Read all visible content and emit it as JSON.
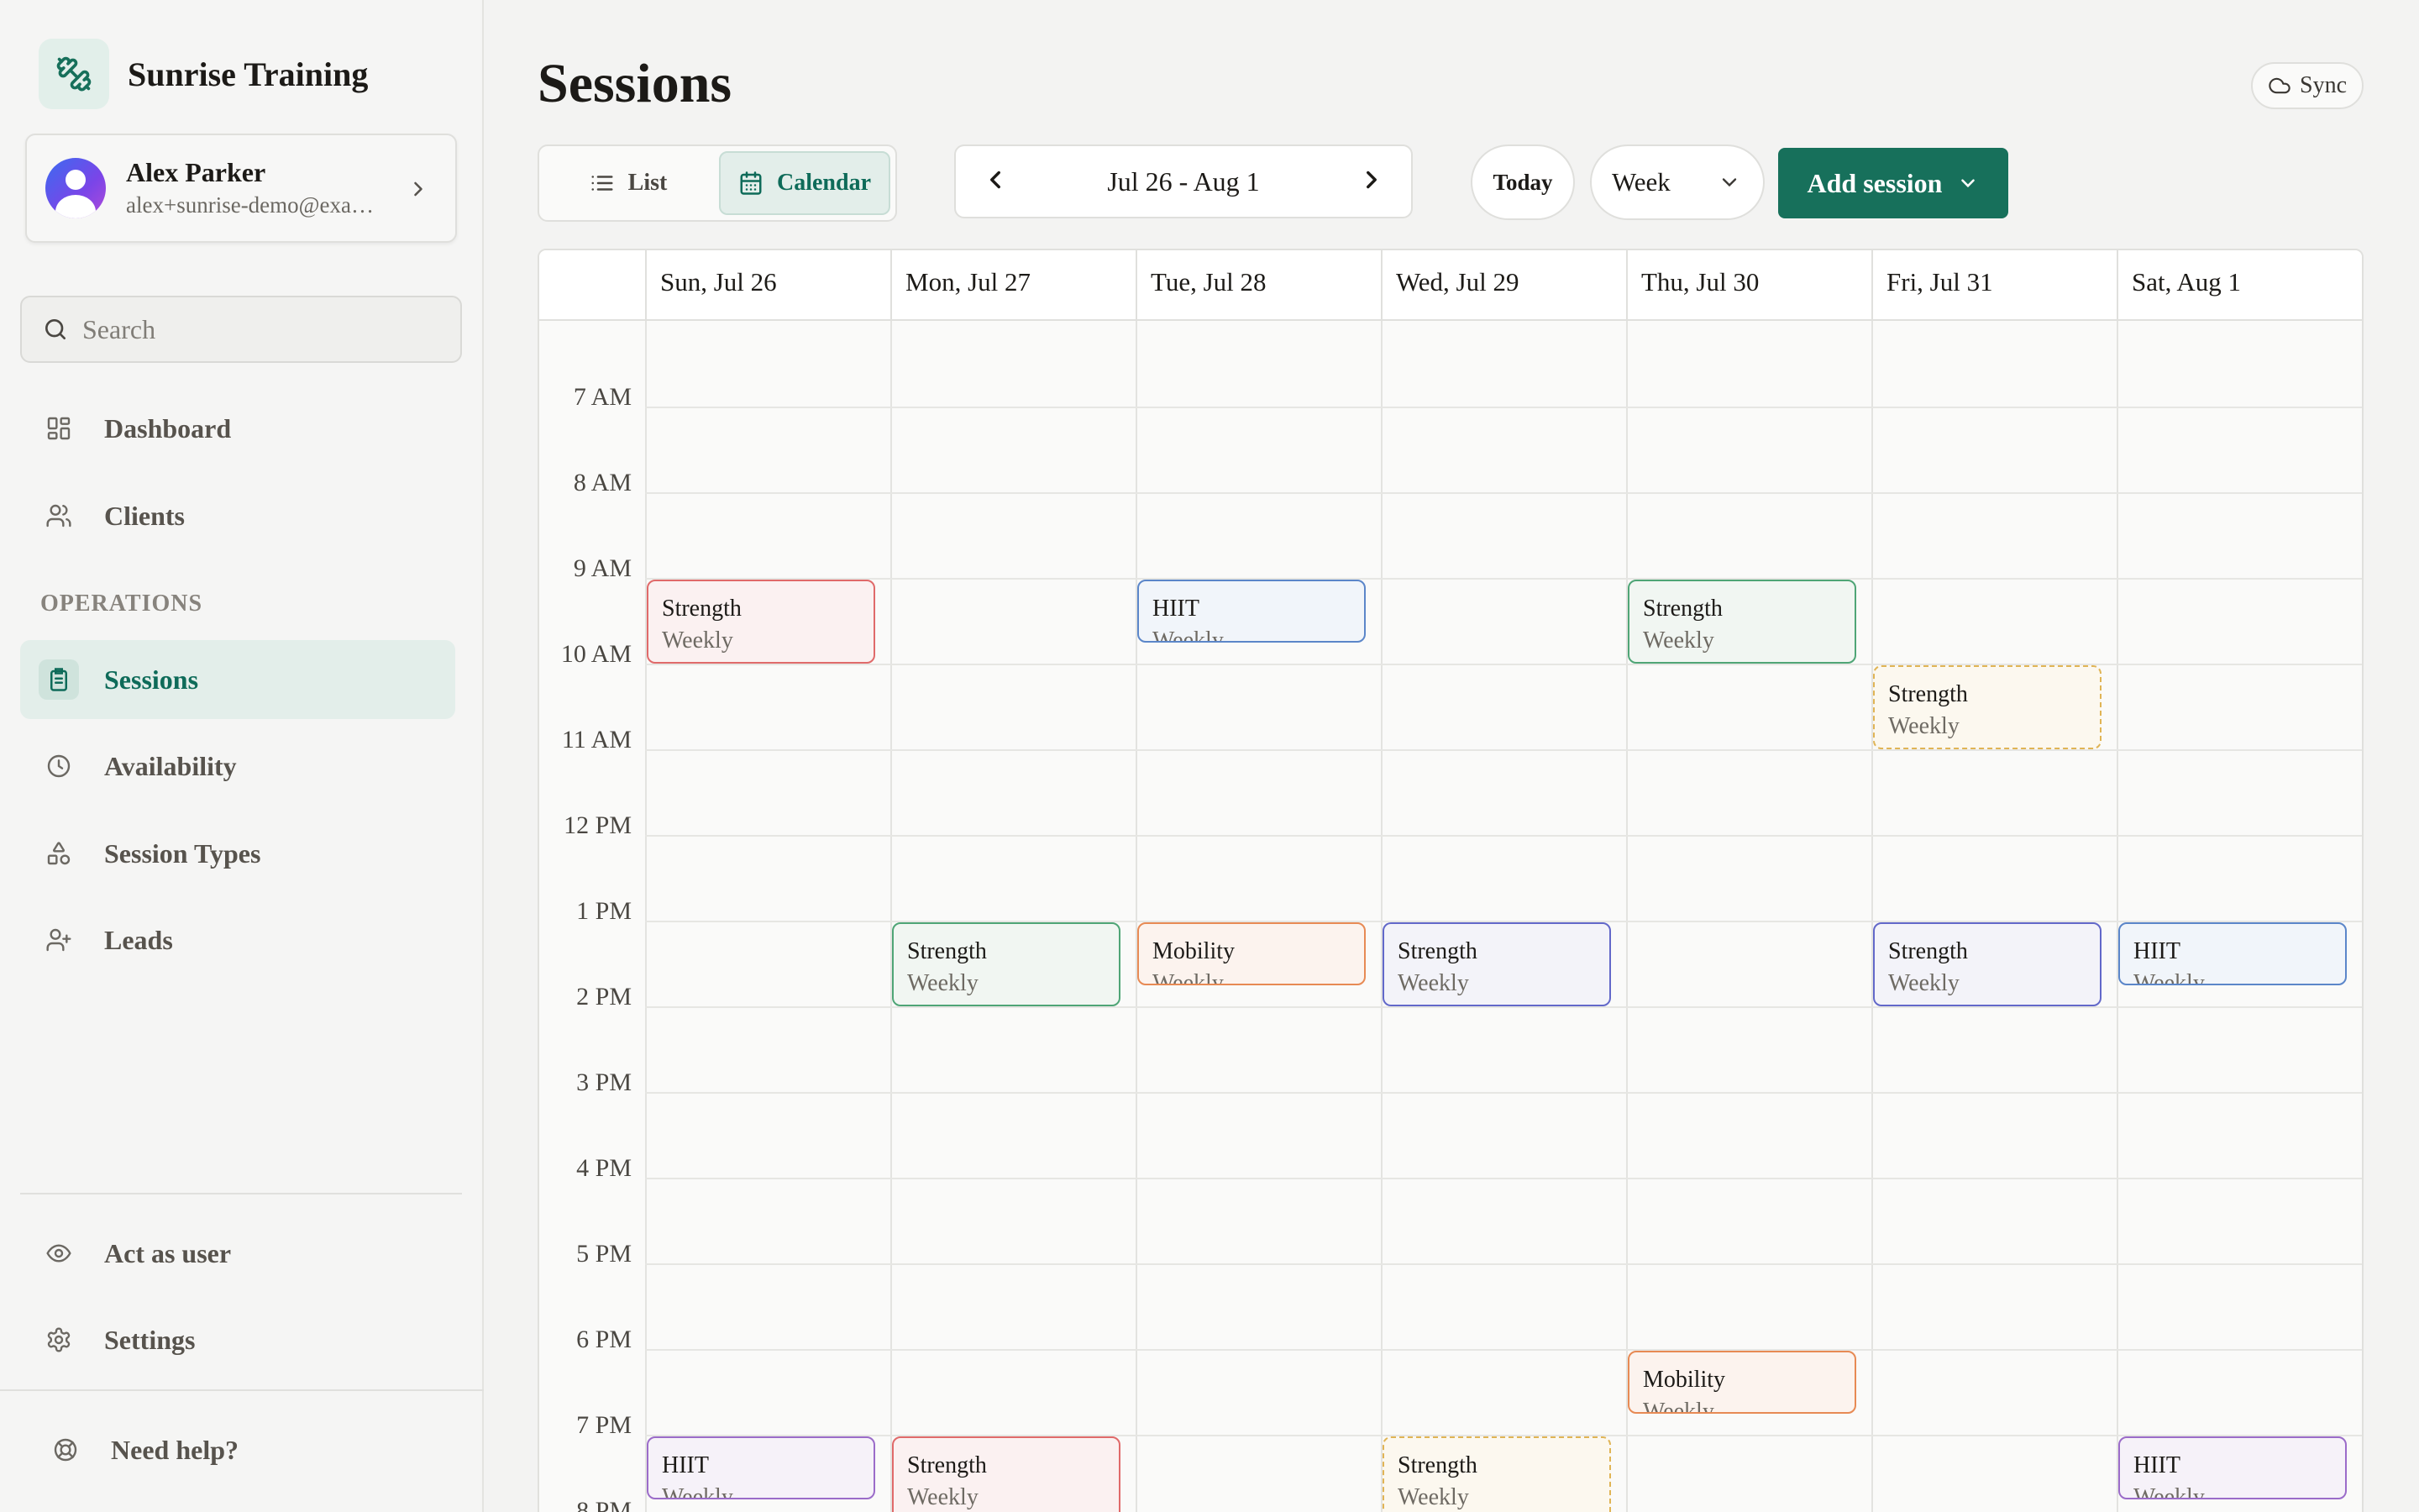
{
  "brand": {
    "name": "Sunrise Training"
  },
  "user": {
    "name": "Alex Parker",
    "email": "alex+sunrise-demo@exa…"
  },
  "search": {
    "placeholder": "Search"
  },
  "nav": {
    "dashboard": "Dashboard",
    "clients": "Clients",
    "section": "OPERATIONS",
    "sessions": "Sessions",
    "availability": "Availability",
    "session_types": "Session Types",
    "leads": "Leads",
    "act_as_user": "Act as user",
    "settings": "Settings",
    "help": "Need help?"
  },
  "header": {
    "title": "Sessions",
    "sync": "Sync",
    "view_list": "List",
    "view_calendar": "Calendar",
    "date_range": "Jul 26 - Aug 1",
    "today": "Today",
    "period": "Week",
    "add_session": "Add session"
  },
  "colors": {
    "accent": "#17705b",
    "red": "#e06a6a",
    "blue": "#5b86c9",
    "green": "#4fa576",
    "yellow": "#e0b455",
    "orange": "#e78a54",
    "indigo": "#6268c9",
    "purple": "#9b6cc9"
  },
  "calendar": {
    "days": [
      "Sun, Jul 26",
      "Mon, Jul 27",
      "Tue, Jul 28",
      "Wed, Jul 29",
      "Thu, Jul 30",
      "Fri, Jul 31",
      "Sat, Aug 1"
    ],
    "hours": [
      "7 AM",
      "8 AM",
      "9 AM",
      "10 AM",
      "11 AM",
      "12 PM",
      "1 PM",
      "2 PM",
      "3 PM",
      "4 PM",
      "5 PM",
      "6 PM",
      "7 PM",
      "8 PM"
    ],
    "events": [
      {
        "day": 0,
        "start": 8.0,
        "end": 9.0,
        "title": "Strength",
        "sub": "Weekly",
        "color": "red"
      },
      {
        "day": 2,
        "start": 8.0,
        "end": 8.75,
        "title": "HIIT",
        "sub": "Weekly",
        "color": "blue"
      },
      {
        "day": 4,
        "start": 8.0,
        "end": 9.0,
        "title": "Strength",
        "sub": "Weekly",
        "color": "green"
      },
      {
        "day": 5,
        "start": 9.0,
        "end": 10.0,
        "title": "Strength",
        "sub": "Weekly",
        "color": "yellow"
      },
      {
        "day": 1,
        "start": 12.0,
        "end": 13.0,
        "title": "Strength",
        "sub": "Weekly",
        "color": "green"
      },
      {
        "day": 2,
        "start": 12.0,
        "end": 12.75,
        "title": "Mobility",
        "sub": "Weekly",
        "color": "orange"
      },
      {
        "day": 3,
        "start": 12.0,
        "end": 13.0,
        "title": "Strength",
        "sub": "Weekly",
        "color": "indigo"
      },
      {
        "day": 5,
        "start": 12.0,
        "end": 13.0,
        "title": "Strength",
        "sub": "Weekly",
        "color": "indigo"
      },
      {
        "day": 6,
        "start": 12.0,
        "end": 12.75,
        "title": "HIIT",
        "sub": "Weekly",
        "color": "blue"
      },
      {
        "day": 4,
        "start": 17.0,
        "end": 17.75,
        "title": "Mobility",
        "sub": "Weekly",
        "color": "orange"
      },
      {
        "day": 0,
        "start": 18.0,
        "end": 18.75,
        "title": "HIIT",
        "sub": "Weekly",
        "color": "purple"
      },
      {
        "day": 1,
        "start": 18.0,
        "end": 19.0,
        "title": "Strength",
        "sub": "Weekly",
        "color": "red"
      },
      {
        "day": 3,
        "start": 18.0,
        "end": 19.0,
        "title": "Strength",
        "sub": "Weekly",
        "color": "yellow"
      },
      {
        "day": 6,
        "start": 18.0,
        "end": 18.75,
        "title": "HIIT",
        "sub": "Weekly",
        "color": "purple"
      }
    ]
  }
}
